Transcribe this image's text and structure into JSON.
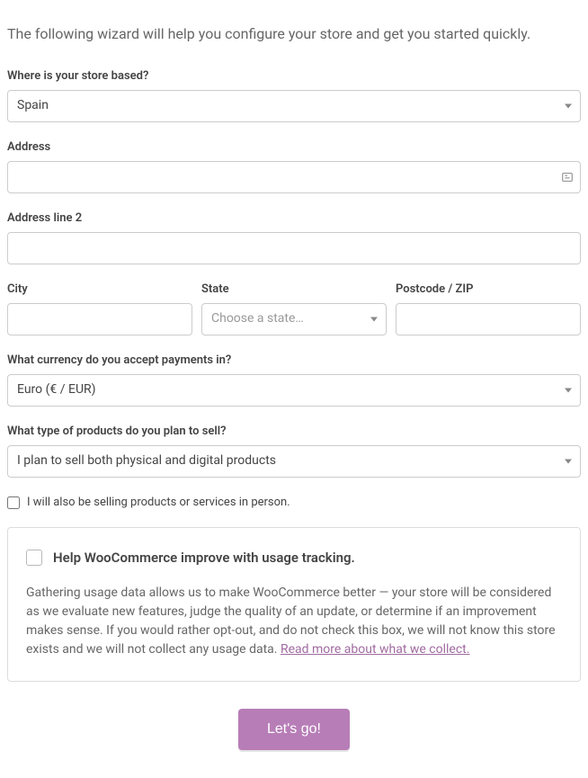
{
  "intro": "The following wizard will help you configure your store and get you started quickly.",
  "fields": {
    "store_location": {
      "label": "Where is your store based?",
      "value": "Spain"
    },
    "address": {
      "label": "Address",
      "value": ""
    },
    "address2": {
      "label": "Address line 2",
      "value": ""
    },
    "city": {
      "label": "City",
      "value": ""
    },
    "state": {
      "label": "State",
      "placeholder": "Choose a state…"
    },
    "postcode": {
      "label": "Postcode / ZIP",
      "value": ""
    },
    "currency": {
      "label": "What currency do you accept payments in?",
      "value": "Euro (€ / EUR)"
    },
    "product_type": {
      "label": "What type of products do you plan to sell?",
      "value": "I plan to sell both physical and digital products"
    },
    "in_person": {
      "label": "I will also be selling products or services in person."
    }
  },
  "tracking": {
    "title": "Help WooCommerce improve with usage tracking.",
    "body": "Gathering usage data allows us to make WooCommerce better — your store will be considered as we evaluate new features, judge the quality of an update, or determine if an improvement makes sense. If you would rather opt-out, and do not check this box, we will not know this store exists and we will not collect any usage data. ",
    "link": "Read more about what we collect."
  },
  "submit": "Let's go!"
}
